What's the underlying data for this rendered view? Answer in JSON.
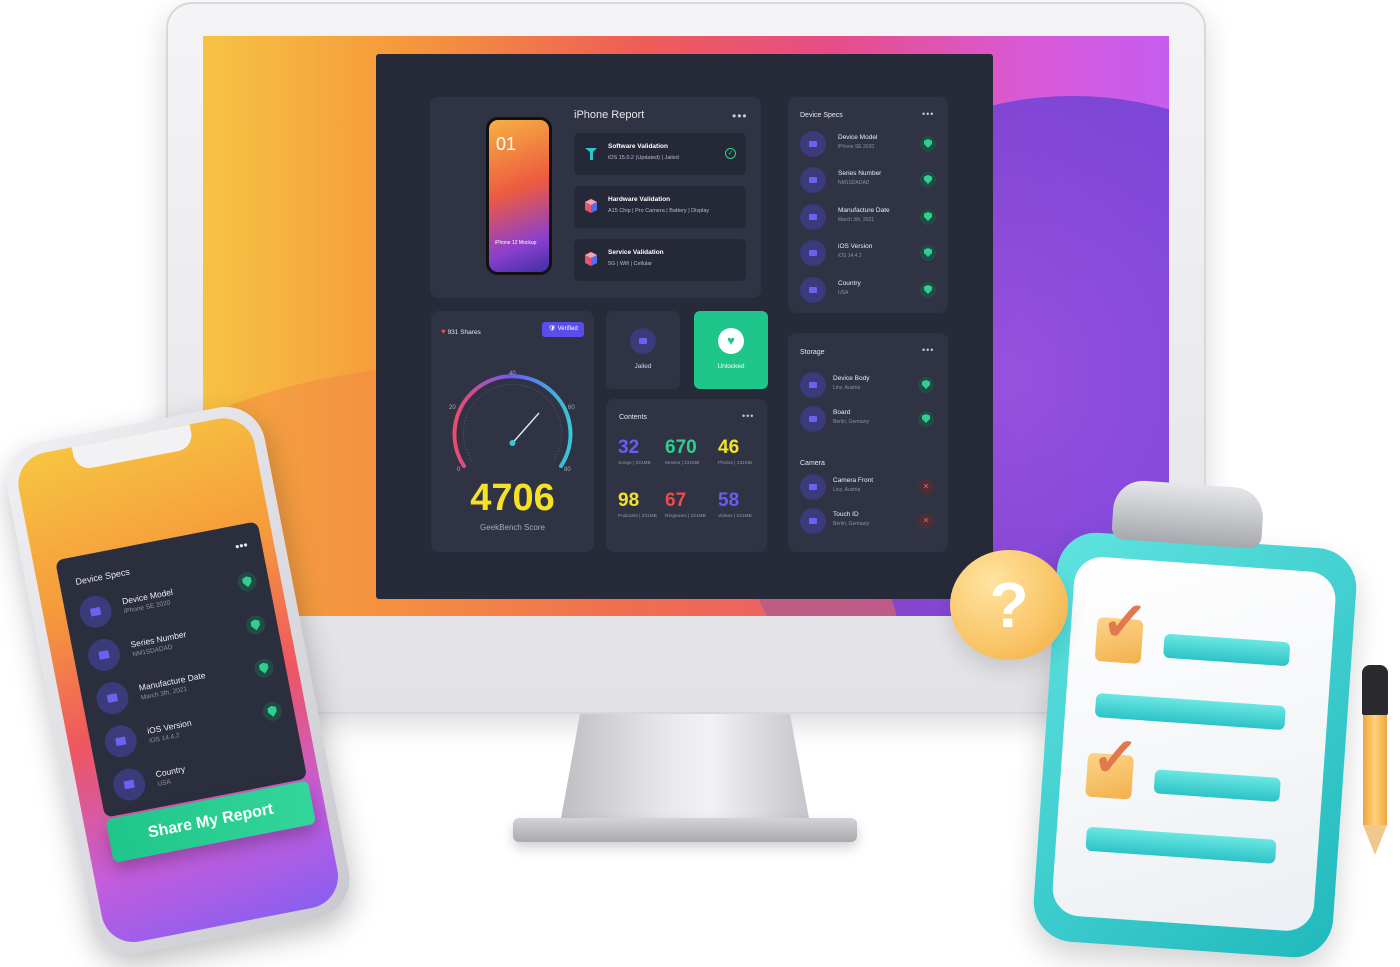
{
  "dashboard": {
    "report": {
      "title": "iPhone Report",
      "phone_number": "01",
      "phone_label": "iPhone\n12 Mockup",
      "items": [
        {
          "title": "Software Validation",
          "sub": "iOS 15.0.2 (Updated) | Jailed",
          "icon": "app-logo-icon"
        },
        {
          "title": "Hardware Validation",
          "sub": "A15 Chip | Pro Camera | Battery | Display",
          "icon": "cube-icon"
        },
        {
          "title": "Service Validation",
          "sub": "5G | Wifi | Cellular",
          "icon": "cube-icon"
        }
      ]
    },
    "device_specs": {
      "title": "Device Specs",
      "rows": [
        {
          "name": "Device Model",
          "value": "iPhone SE 2020"
        },
        {
          "name": "Series Number",
          "value": "NM1SDADAD"
        },
        {
          "name": "Manufacture Date",
          "value": "March 3th, 2021"
        },
        {
          "name": "iOS Version",
          "value": "iOS 14.4.2"
        },
        {
          "name": "Country",
          "value": "USA"
        }
      ]
    },
    "geekbench": {
      "shares": "931 Shares",
      "verified": "Verified",
      "ticks": [
        "0",
        "20",
        "40",
        "60",
        "80"
      ],
      "score": "4706",
      "score_label": "GeekBench Score"
    },
    "status": {
      "jailed": "Jailed",
      "unlocked": "Unlocked"
    },
    "contents": {
      "title": "Contents",
      "items": [
        {
          "value": "32",
          "label": "Songs | 231MB",
          "color": "#6a5cf5"
        },
        {
          "value": "670",
          "label": "Movies | 231MB",
          "color": "#2fd08f"
        },
        {
          "value": "46",
          "label": "Photos | 231MB",
          "color": "#f5e226"
        },
        {
          "value": "98",
          "label": "Podcasts | 231MB",
          "color": "#f5e226"
        },
        {
          "value": "67",
          "label": "Ringtones | 231MB",
          "color": "#ef4b4b"
        },
        {
          "value": "58",
          "label": "Videos | 231MB",
          "color": "#6a5cf5"
        }
      ]
    },
    "storage": {
      "title": "Storage",
      "rows": [
        {
          "name": "Device Body",
          "value": "Linz, Austria"
        },
        {
          "name": "Board",
          "value": "Berlin, Germany"
        }
      ]
    },
    "camera": {
      "title": "Camera",
      "rows": [
        {
          "name": "Camera Front",
          "value": "Linz, Austria"
        },
        {
          "name": "Touch ID",
          "value": "Berlin, Germany"
        }
      ]
    },
    "dots": "•••"
  },
  "phone": {
    "title": "Device Specs",
    "rows": [
      {
        "name": "Device Model",
        "value": "iPhone SE 2020"
      },
      {
        "name": "Series Number",
        "value": "NM1SDADAD"
      },
      {
        "name": "Manufacture Date",
        "value": "March 3th, 2021"
      },
      {
        "name": "iOS Version",
        "value": "iOS 14.4.2"
      },
      {
        "name": "Country",
        "value": "USA"
      }
    ],
    "share_button": "Share My Report"
  },
  "clipboard": {
    "question_mark": "?",
    "tick": "✓"
  },
  "colors": {
    "accent_green": "#2fd08f",
    "accent_purple": "#5b4cf0",
    "score_yellow": "#f5e226",
    "panel_bg": "#2f3344"
  }
}
